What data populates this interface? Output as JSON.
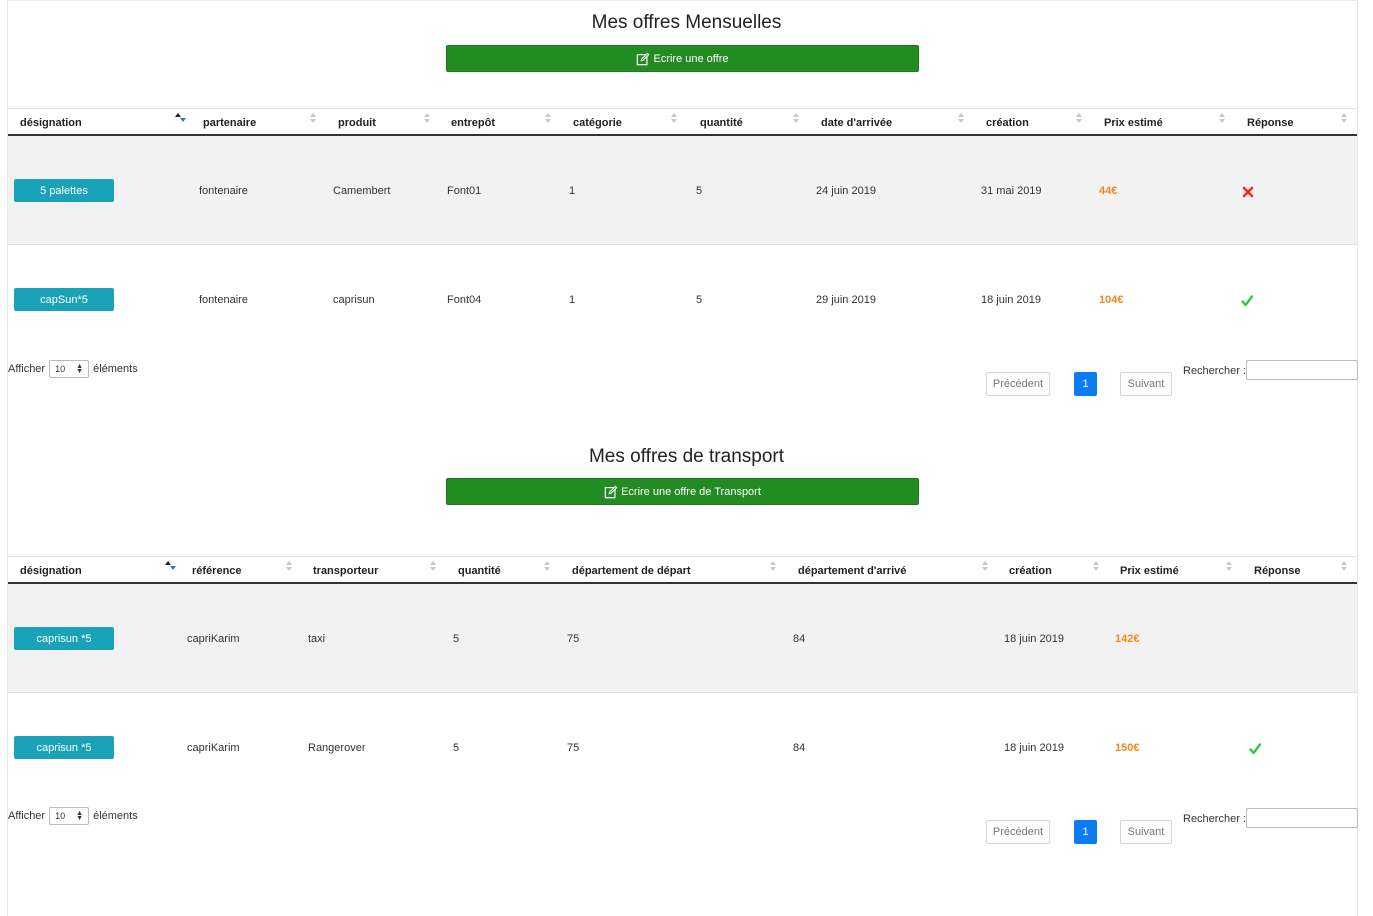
{
  "monthly": {
    "title": "Mes offres Mensuelles",
    "write_button": "Ecrire une offre",
    "columns": [
      "désignation",
      "partenaire",
      "produit",
      "entrepôt",
      "catégorie",
      "quantité",
      "date d'arrivée",
      "création",
      "Prix estimé",
      "Réponse"
    ],
    "rows": [
      {
        "designation": "5 palettes",
        "partenaire": "fontenaire",
        "produit": "Camembert",
        "entrepot": "Font01",
        "categorie": "1",
        "quantite": "5",
        "date_arrivee": "24 juin 2019",
        "creation": "31 mai 2019",
        "prix": "44€",
        "reponse": "cross-icon"
      },
      {
        "designation": "capSun*5",
        "partenaire": "fontenaire",
        "produit": "caprisun",
        "entrepot": "Font04",
        "categorie": "1",
        "quantite": "5",
        "date_arrivee": "29 juin 2019",
        "creation": "18 juin 2019",
        "prix": "104€",
        "reponse": "check-icon"
      }
    ],
    "length": {
      "prefix": "Afficher",
      "value": "10",
      "suffix": "éléments"
    },
    "pagination": {
      "prev": "Précédent",
      "page": "1",
      "next": "Suivant"
    },
    "search": {
      "label": "Rechercher :",
      "value": ""
    }
  },
  "transport": {
    "title": "Mes offres de transport",
    "write_button": "Ecrire une offre de Transport",
    "columns": [
      "désignation",
      "référence",
      "transporteur",
      "quantité",
      "département de départ",
      "département d'arrivé",
      "création",
      "Prix estimé",
      "Réponse"
    ],
    "rows": [
      {
        "designation": "caprisun *5",
        "reference": "capriKarim",
        "transporteur": "taxi",
        "quantite": "5",
        "dep_depart": "75",
        "dep_arrive": "84",
        "creation": "18 juin 2019",
        "prix": "142€",
        "reponse": ""
      },
      {
        "designation": "caprisun *5",
        "reference": "capriKarim",
        "transporteur": "Rangerover",
        "quantite": "5",
        "dep_depart": "75",
        "dep_arrive": "84",
        "creation": "18 juin 2019",
        "prix": "150€",
        "reponse": "check-icon"
      }
    ],
    "length": {
      "prefix": "Afficher",
      "value": "10",
      "suffix": "éléments"
    },
    "pagination": {
      "prev": "Précédent",
      "page": "1",
      "next": "Suivant"
    },
    "search": {
      "label": "Rechercher :",
      "value": ""
    }
  },
  "colors": {
    "green_button": "#228b22",
    "teal_button": "#1aa3b8",
    "price": "#f28a1a",
    "page_active": "#0d7bf2",
    "cross": "#e03030",
    "check": "#2ecc40"
  }
}
